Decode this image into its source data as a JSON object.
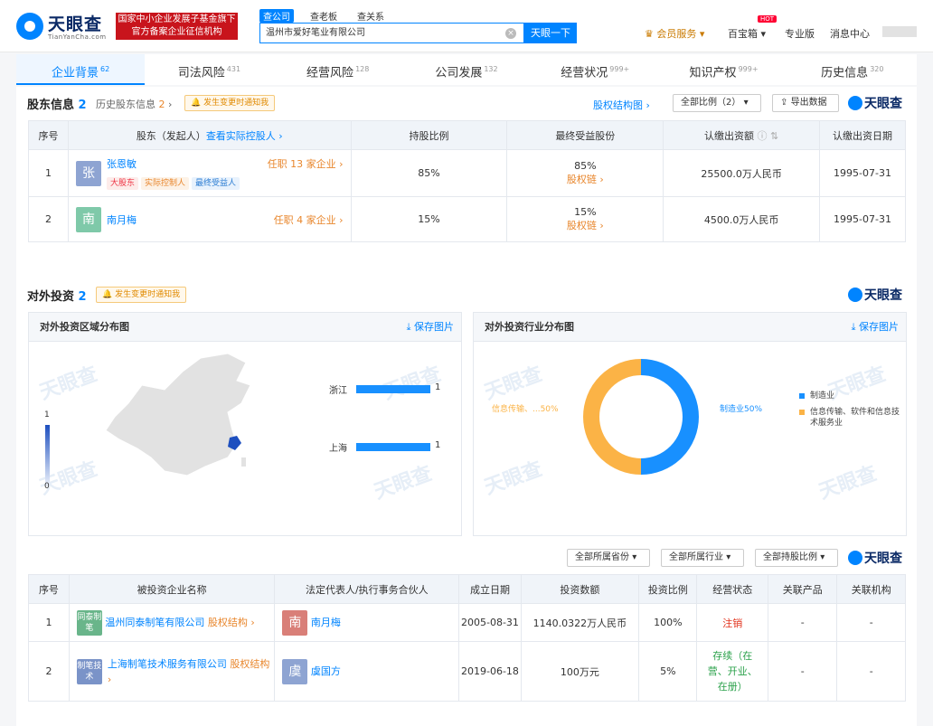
{
  "header": {
    "logo_cn": "天眼查",
    "logo_en": "TianYanCha.com",
    "badge_line1": "国家中小企业发展子基金旗下",
    "badge_line2": "官方备案企业征信机构",
    "search_tabs": [
      "查公司",
      "查老板",
      "查关系"
    ],
    "search_value": "温州市爱好笔业有限公司",
    "search_button": "天眼一下",
    "nav": {
      "vip": "会员服务",
      "tool": "百宝箱",
      "hot": "HOT",
      "pro": "专业版",
      "msg": "消息中心"
    }
  },
  "tabs": [
    {
      "label": "企业背景",
      "count": "62"
    },
    {
      "label": "司法风险",
      "count": "431"
    },
    {
      "label": "经营风险",
      "count": "128"
    },
    {
      "label": "公司发展",
      "count": "132"
    },
    {
      "label": "经营状况",
      "count": "999+"
    },
    {
      "label": "知识产权",
      "count": "999+"
    },
    {
      "label": "历史信息",
      "count": "320"
    }
  ],
  "shareholders": {
    "title": "股东信息",
    "count": "2",
    "history": "历史股东信息",
    "history_count": "2",
    "notice": "发生变更时通知我",
    "struct": "股权结构图",
    "filter": "全部比例（2）",
    "export": "导出数据",
    "brand": "天眼查",
    "headers": [
      "序号",
      "股东（发起人）",
      "查看实际控股人",
      "持股比例",
      "最终受益股份",
      "认缴出资额",
      "认缴出资日期"
    ],
    "rows": [
      {
        "no": "1",
        "avatar": "张",
        "name": "张恩敏",
        "role": "任职 13 家企业",
        "tags": [
          "大股东",
          "实际控制人",
          "最终受益人"
        ],
        "ratio": "85%",
        "benefit": "85%",
        "chain": "股权链",
        "amount": "25500.0万人民币",
        "date": "1995-07-31"
      },
      {
        "no": "2",
        "avatar": "南",
        "name": "南月梅",
        "role": "任职 4 家企业",
        "tags": [],
        "ratio": "15%",
        "benefit": "15%",
        "chain": "股权链",
        "amount": "4500.0万人民币",
        "date": "1995-07-31"
      }
    ]
  },
  "investment": {
    "title": "对外投资",
    "count": "2",
    "notice": "发生变更时通知我",
    "brand": "天眼查",
    "region_panel": {
      "title": "对外投资区域分布图",
      "save": "保存图片",
      "scale_max": "1",
      "scale_min": "0"
    },
    "industry_panel": {
      "title": "对外投资行业分布图",
      "save": "保存图片"
    },
    "filters": [
      "全部所属省份",
      "全部所属行业",
      "全部持股比例"
    ],
    "headers": [
      "序号",
      "被投资企业名称",
      "法定代表人/执行事务合伙人",
      "成立日期",
      "投资数额",
      "投资比例",
      "经营状态",
      "关联产品",
      "关联机构"
    ],
    "rows": [
      {
        "no": "1",
        "logo": "同泰制笔",
        "name": "温州同泰制笔有限公司",
        "struct": "股权结构",
        "rep_avatar": "南",
        "rep": "南月梅",
        "date": "2005-08-31",
        "amount": "1140.0322万人民币",
        "ratio": "100%",
        "status": "注销",
        "product": "-",
        "org": "-"
      },
      {
        "no": "2",
        "logo": "制笔技术",
        "name": "上海制笔技术服务有限公司",
        "struct": "股权结构",
        "rep_avatar": "虞",
        "rep": "虞国方",
        "date": "2019-06-18",
        "amount": "100万元",
        "ratio": "5%",
        "status": "存续（在营、开业、在册）",
        "product": "-",
        "org": "-"
      }
    ]
  },
  "chart_data": [
    {
      "type": "bar",
      "title": "对外投资区域分布图",
      "categories": [
        "浙江",
        "上海"
      ],
      "values": [
        1,
        1
      ],
      "xlim": [
        0,
        1
      ]
    },
    {
      "type": "pie",
      "title": "对外投资行业分布图",
      "categories": [
        "制造业",
        "信息传输、软件和信息技术服务业"
      ],
      "values": [
        50,
        50
      ],
      "labels": [
        "制造业50%",
        "信息传输、...50%"
      ],
      "colors": [
        "#1890ff",
        "#fbb346"
      ],
      "legend": "right"
    }
  ]
}
